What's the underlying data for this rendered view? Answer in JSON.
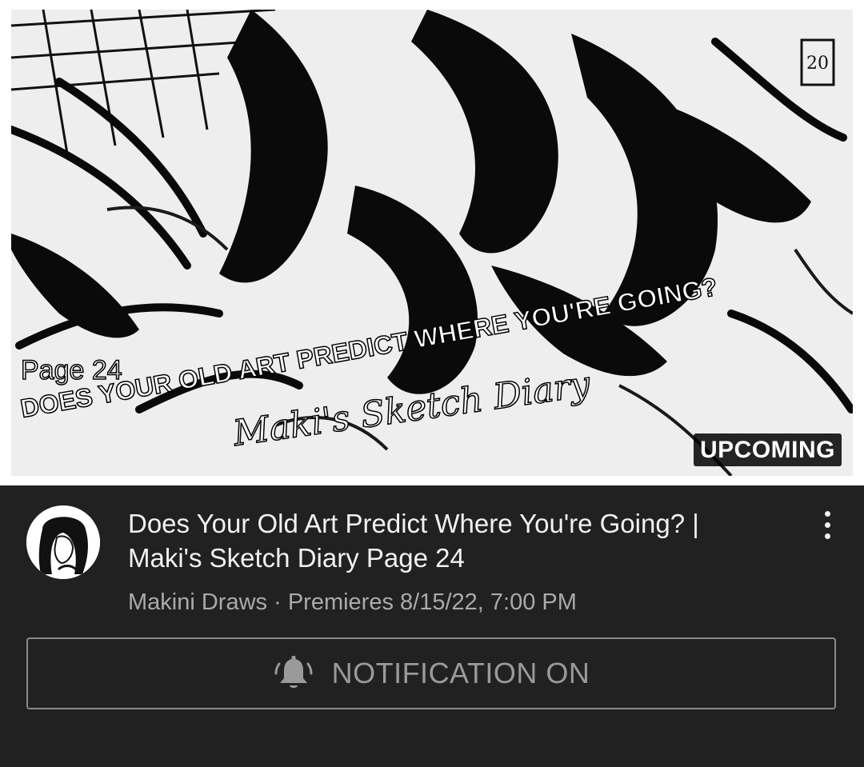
{
  "thumbnail": {
    "overlay_line1": "Page 24",
    "overlay_line2": "DOES YOUR OLD ART PREDICT WHERE YOU'RE GOING?",
    "overlay_line3": "Maki's Sketch Diary",
    "badge": "UPCOMING"
  },
  "video": {
    "title": "Does Your Old Art Predict Where You're Going? | Maki's Sketch Diary Page 24",
    "channel": "Makini Draws",
    "separator": "·",
    "premiere": "Premieres 8/15/22, 7:00 PM"
  },
  "menu": {
    "icon": "more-vert-icon"
  },
  "notification_button": {
    "label": "NOTIFICATION ON",
    "icon": "bell-ringing-icon"
  },
  "colors": {
    "background": "#212121",
    "title_text": "#f1f1f1",
    "secondary_text": "#aaaaaa",
    "button_border": "#8a8a8a"
  }
}
